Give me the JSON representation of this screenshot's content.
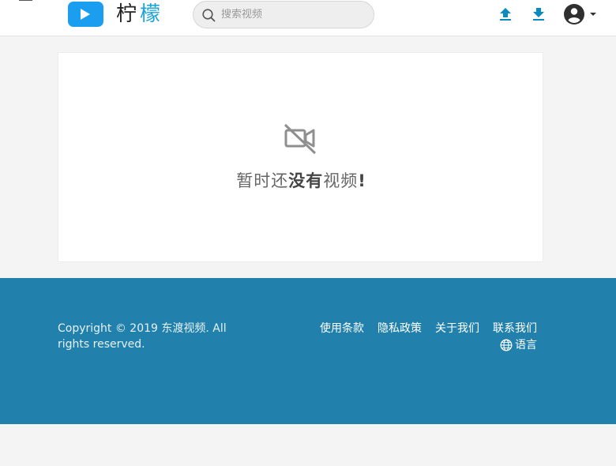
{
  "header": {
    "logo_char_1": "柠",
    "logo_char_2": "檬",
    "search_placeholder": "搜索视频"
  },
  "main": {
    "empty_prefix": "暂时还",
    "empty_bold": "没有",
    "empty_suffix": "视频",
    "empty_mark": "!"
  },
  "footer": {
    "copyright": "Copyright © 2019 东渡视频. All rights reserved.",
    "links": [
      "使用条款",
      "隐私政策",
      "关于我们",
      "联系我们"
    ],
    "language": "语言"
  },
  "colors": {
    "accent": "#1b9ef0",
    "logo_second_char": "#1aa3d9",
    "upload_download": "#0a8bbf",
    "footer_bg": "#2181ac"
  },
  "icons": [
    "menu-icon",
    "play-icon",
    "search-icon",
    "upload-icon",
    "download-icon",
    "account-icon",
    "caret-down-icon",
    "video-off-icon",
    "globe-icon"
  ]
}
